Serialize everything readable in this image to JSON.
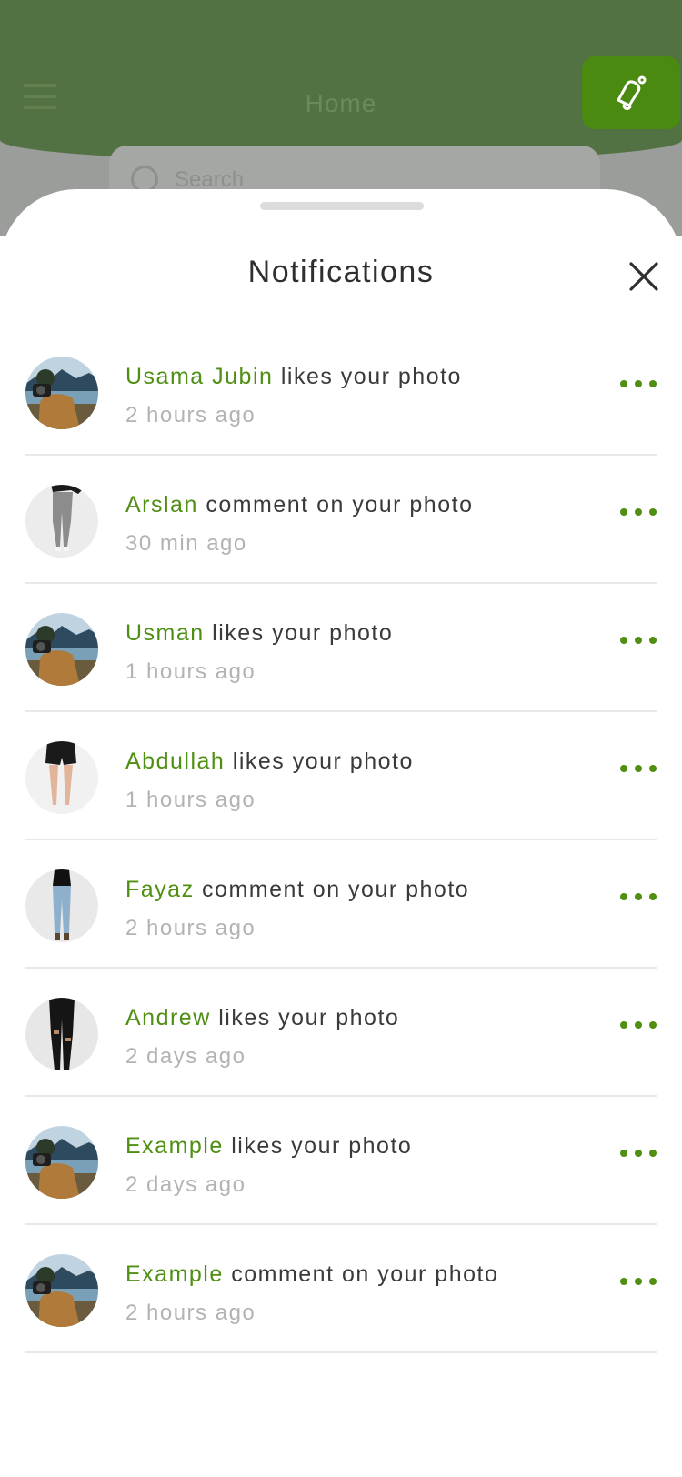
{
  "background_app": {
    "title": "Home",
    "search_placeholder": "Search"
  },
  "sheet": {
    "title": "Notifications"
  },
  "notifications": [
    {
      "name": "Usama Jubin",
      "action": " likes your photo",
      "time": "2 hours ago",
      "avatar": "lake-camera"
    },
    {
      "name": "Arslan",
      "action": " comment on your photo",
      "time": "30 min ago",
      "avatar": "grey-jeans"
    },
    {
      "name": "Usman",
      "action": " likes your photo",
      "time": "1 hours ago",
      "avatar": "lake-camera"
    },
    {
      "name": "Abdullah",
      "action": " likes your photo",
      "time": "1 hours ago",
      "avatar": "black-shorts"
    },
    {
      "name": "Fayaz",
      "action": " comment on your photo",
      "time": "2 hours ago",
      "avatar": "blue-jeans"
    },
    {
      "name": "Andrew",
      "action": " likes your photo",
      "time": "2 days ago",
      "avatar": "black-ripped-jeans"
    },
    {
      "name": "Example",
      "action": " likes your photo",
      "time": "2 days ago",
      "avatar": "lake-camera"
    },
    {
      "name": "Example",
      "action": " comment on your photo",
      "time": "2 hours ago",
      "avatar": "lake-camera"
    }
  ],
  "colors": {
    "accent": "#4f8f12",
    "header_green": "#537243",
    "text": "#3a3a3a",
    "muted": "#b3b3b3"
  }
}
